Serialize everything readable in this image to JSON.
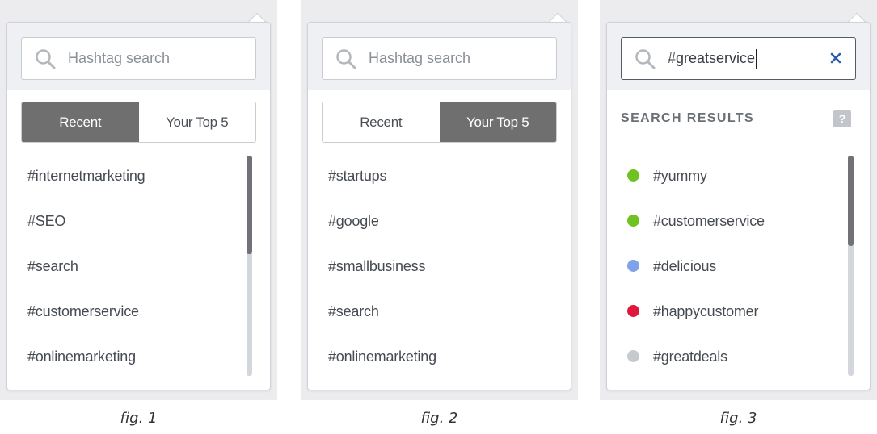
{
  "colors": {
    "tab_active_bg": "#6f6f70",
    "dot_green": "#6fc21f",
    "dot_blue": "#7ea3ea",
    "dot_red": "#e0183c",
    "dot_gray": "#c7cacd",
    "clear_x": "#2b5fa8"
  },
  "figures": [
    {
      "search": {
        "placeholder": "Hashtag search"
      },
      "tabs": [
        {
          "label": "Recent",
          "active": true
        },
        {
          "label": "Your Top 5",
          "active": false
        }
      ],
      "items": [
        "#internetmarketing",
        "#SEO",
        "#search",
        "#customerservice",
        "#onlinemarketing"
      ],
      "caption": "fig. 1"
    },
    {
      "search": {
        "placeholder": "Hashtag search"
      },
      "tabs": [
        {
          "label": "Recent",
          "active": false
        },
        {
          "label": "Your Top 5",
          "active": true
        }
      ],
      "items": [
        "#startups",
        "#google",
        "#smallbusiness",
        "#search",
        "#onlinemarketing"
      ],
      "caption": "fig. 2"
    },
    {
      "search": {
        "value": "#greatservice"
      },
      "results_heading": "SEARCH RESULTS",
      "help_label": "?",
      "results": [
        {
          "tag": "#yummy",
          "color": "#6fc21f"
        },
        {
          "tag": "#customerservice",
          "color": "#6fc21f"
        },
        {
          "tag": "#delicious",
          "color": "#7ea3ea"
        },
        {
          "tag": "#happycustomer",
          "color": "#e0183c"
        },
        {
          "tag": "#greatdeals",
          "color": "#c7cacd"
        }
      ],
      "caption": "fig. 3"
    }
  ]
}
